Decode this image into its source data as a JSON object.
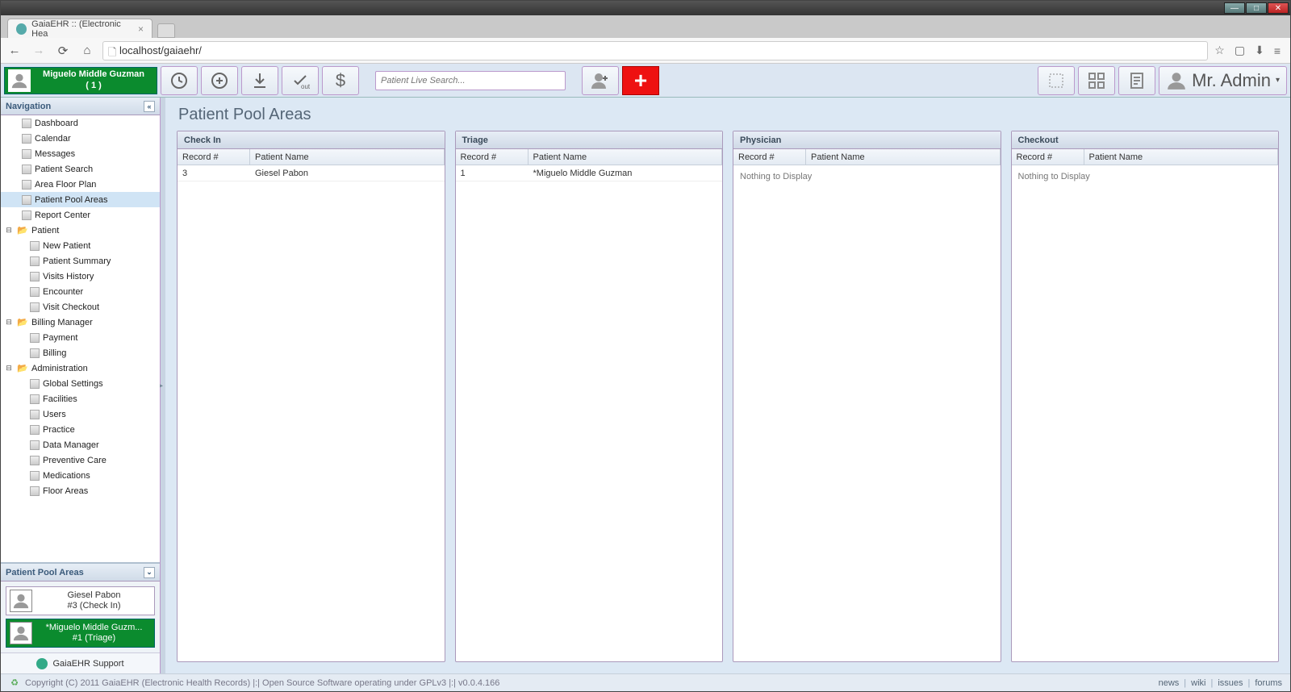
{
  "browser": {
    "tab_title": "GaiaEHR :: (Electronic Hea",
    "url": "localhost/gaiaehr/"
  },
  "toolbar": {
    "patient_badge": {
      "name": "Miguelo Middle Guzman",
      "sub": "( 1 )"
    },
    "search_placeholder": "Patient Live Search...",
    "user_label": "Mr. Admin"
  },
  "sidebar": {
    "nav_title": "Navigation",
    "items": [
      {
        "label": "Dashboard",
        "type": "leaf"
      },
      {
        "label": "Calendar",
        "type": "leaf"
      },
      {
        "label": "Messages",
        "type": "leaf"
      },
      {
        "label": "Patient Search",
        "type": "leaf"
      },
      {
        "label": "Area Floor Plan",
        "type": "leaf"
      },
      {
        "label": "Patient Pool Areas",
        "type": "leaf",
        "selected": true
      },
      {
        "label": "Report Center",
        "type": "leaf"
      },
      {
        "label": "Patient",
        "type": "parent"
      },
      {
        "label": "New Patient",
        "type": "child"
      },
      {
        "label": "Patient Summary",
        "type": "child"
      },
      {
        "label": "Visits History",
        "type": "child"
      },
      {
        "label": "Encounter",
        "type": "child"
      },
      {
        "label": "Visit Checkout",
        "type": "child"
      },
      {
        "label": "Billing Manager",
        "type": "parent"
      },
      {
        "label": "Payment",
        "type": "child"
      },
      {
        "label": "Billing",
        "type": "child"
      },
      {
        "label": "Administration",
        "type": "parent"
      },
      {
        "label": "Global Settings",
        "type": "child"
      },
      {
        "label": "Facilities",
        "type": "child"
      },
      {
        "label": "Users",
        "type": "child"
      },
      {
        "label": "Practice",
        "type": "child"
      },
      {
        "label": "Data Manager",
        "type": "child"
      },
      {
        "label": "Preventive Care",
        "type": "child"
      },
      {
        "label": "Medications",
        "type": "child"
      },
      {
        "label": "Floor Areas",
        "type": "child"
      }
    ],
    "pool_title": "Patient Pool Areas",
    "pool_cards": [
      {
        "name": "Giesel Pabon",
        "sub": "#3 (Check In)",
        "active": false
      },
      {
        "name": "*Miguelo Middle Guzm...",
        "sub": "#1 (Triage)",
        "active": true
      }
    ],
    "support_label": "GaiaEHR Support"
  },
  "main": {
    "title": "Patient Pool Areas",
    "columns": [
      {
        "title": "Check In",
        "headers": [
          "Record #",
          "Patient Name"
        ],
        "rows": [
          {
            "rec": "3",
            "name": "Giesel Pabon"
          }
        ]
      },
      {
        "title": "Triage",
        "headers": [
          "Record #",
          "Patient Name"
        ],
        "rows": [
          {
            "rec": "1",
            "name": "*Miguelo Middle Guzman"
          }
        ]
      },
      {
        "title": "Physician",
        "headers": [
          "Record #",
          "Patient Name"
        ],
        "rows": [],
        "empty": "Nothing to Display"
      },
      {
        "title": "Checkout",
        "headers": [
          "Record #",
          "Patient Name"
        ],
        "rows": [],
        "empty": "Nothing to Display"
      }
    ]
  },
  "footer": {
    "copyright": "Copyright (C) 2011 GaiaEHR (Electronic Health Records) |:| Open Source Software operating under GPLv3 |:| v0.0.4.166",
    "links": [
      "news",
      "wiki",
      "issues",
      "forums"
    ]
  }
}
